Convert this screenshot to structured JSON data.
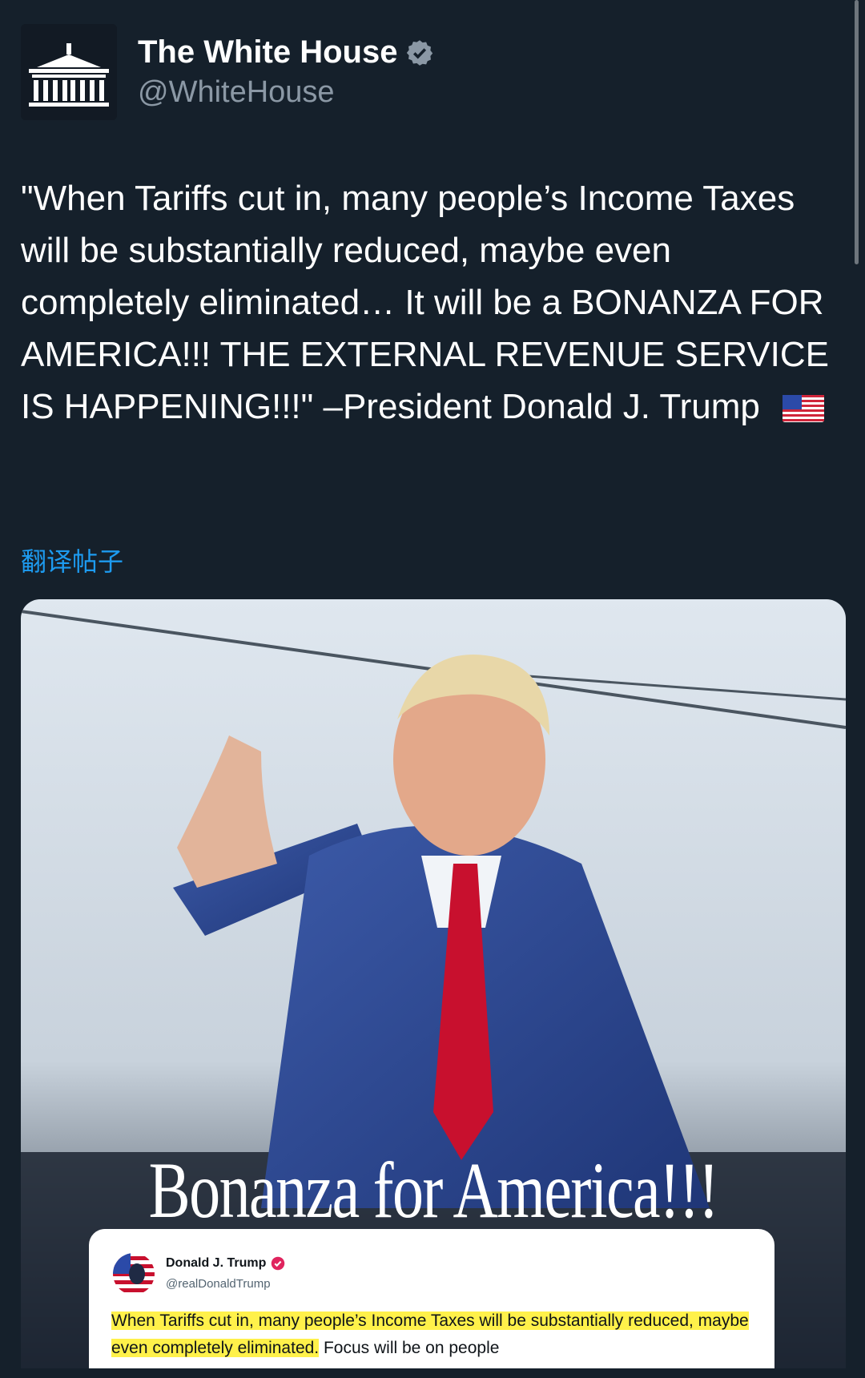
{
  "account": {
    "display_name": "The White House",
    "handle": "@WhiteHouse"
  },
  "tweet": {
    "text": "\"When Tariffs cut in, many people’s Income Taxes will be substantially reduced, maybe even completely eliminated… It will be a BONANZA FOR AMERICA!!! THE EXTERNAL REVENUE SERVICE IS HAPPENING!!!\" –President Donald J. Trump",
    "emoji": "us-flag-emoji"
  },
  "translate_label": "翻译帖子",
  "media": {
    "caption": "Bonanza for America!!!",
    "embedded_post": {
      "name": "Donald J. Trump",
      "handle": "@realDonaldTrump",
      "highlighted_text": "When Tariffs cut in, many people’s Income Taxes will be substantially reduced, maybe even completely eliminated.",
      "rest_text": " Focus will be on people"
    }
  },
  "colors": {
    "background": "#15202b",
    "link": "#1d9bf0",
    "verified": "#8b98a5",
    "highlight": "#fff14a"
  }
}
